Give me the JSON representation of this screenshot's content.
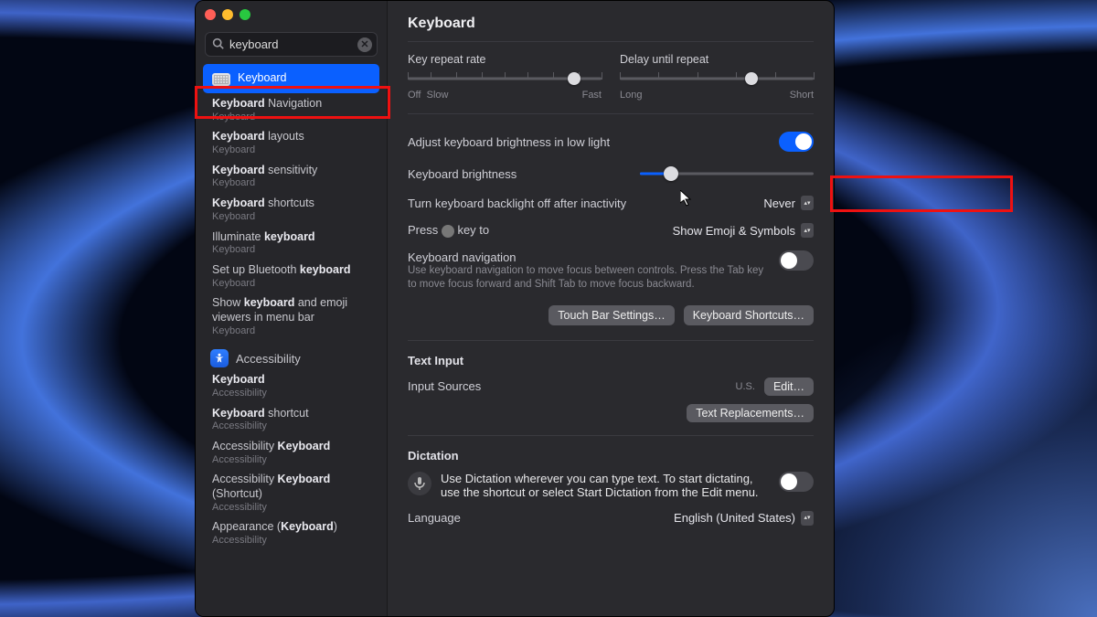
{
  "window_title": "Keyboard",
  "search": {
    "value": "keyboard"
  },
  "sidebar": {
    "selected": {
      "label": "Keyboard"
    },
    "items": [
      {
        "title_html": "<b>Keyboard</b> Navigation",
        "sub": "Keyboard"
      },
      {
        "title_html": "<b>Keyboard</b> layouts",
        "sub": "Keyboard"
      },
      {
        "title_html": "<b>Keyboard</b> sensitivity",
        "sub": "Keyboard"
      },
      {
        "title_html": "<b>Keyboard</b> shortcuts",
        "sub": "Keyboard"
      },
      {
        "title_html": "Illuminate <b>keyboard</b>",
        "sub": "Keyboard"
      },
      {
        "title_html": "Set up Bluetooth <b>keyboard</b>",
        "sub": "Keyboard"
      },
      {
        "title_html": "Show <b>keyboard</b> and emoji viewers in menu bar",
        "sub": "Keyboard"
      }
    ],
    "accessibility_header": "Accessibility",
    "acc_items": [
      {
        "title_html": "<b>Keyboard</b>",
        "sub": "Accessibility"
      },
      {
        "title_html": "<b>Keyboard</b> shortcut",
        "sub": "Accessibility"
      },
      {
        "title_html": "Accessibility <b>Keyboard</b>",
        "sub": "Accessibility"
      },
      {
        "title_html": "Accessibility <b>Keyboard</b> (Shortcut)",
        "sub": "Accessibility"
      },
      {
        "title_html": "Appearance (<b>Keyboard</b>)",
        "sub": "Accessibility"
      }
    ]
  },
  "sliders": {
    "key_repeat": {
      "label": "Key repeat rate",
      "left": "Off",
      "left2": "Slow",
      "right": "Fast",
      "position_pct": 86
    },
    "delay_repeat": {
      "label": "Delay until repeat",
      "left": "Long",
      "right": "Short",
      "position_pct": 68
    },
    "brightness": {
      "label": "Keyboard brightness",
      "position_pct": 18
    }
  },
  "settings": {
    "auto_brightness": {
      "label": "Adjust keyboard brightness in low light",
      "on": true
    },
    "backlight_off": {
      "label": "Turn keyboard backlight off after inactivity",
      "value": "Never"
    },
    "press_key": {
      "label": "Press 🌐 key to",
      "value": "Show Emoji & Symbols"
    },
    "nav": {
      "label": "Keyboard navigation",
      "desc": "Use keyboard navigation to move focus between controls. Press the Tab key to move focus forward and Shift Tab to move focus backward.",
      "on": false
    },
    "buttons": {
      "touchbar": "Touch Bar Settings…",
      "shortcuts": "Keyboard Shortcuts…"
    }
  },
  "text_input": {
    "title": "Text Input",
    "sources_label": "Input Sources",
    "sources_value": "U.S.",
    "edit": "Edit…",
    "replacements": "Text Replacements…"
  },
  "dictation": {
    "title": "Dictation",
    "desc": "Use Dictation wherever you can type text. To start dictating, use the shortcut or select Start Dictation from the Edit menu.",
    "on": false,
    "language_label": "Language",
    "language_value": "English (United States)"
  }
}
